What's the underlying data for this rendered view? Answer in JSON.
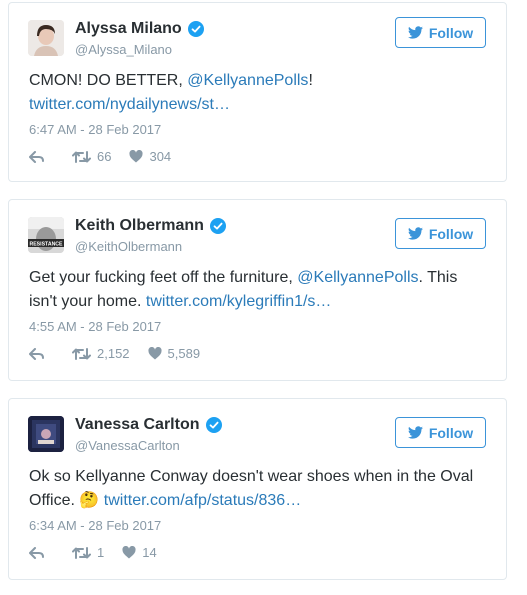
{
  "tweets": [
    {
      "name": "Alyssa Milano",
      "handle": "@Alyssa_Milano",
      "follow_label": "Follow",
      "text_before": "CMON! DO BETTER, ",
      "mention": "@KellyannePolls",
      "text_after": "!",
      "link": "twitter.com/nydailynews/st…",
      "timestamp": "6:47 AM - 28 Feb 2017",
      "retweets": "66",
      "likes": "304"
    },
    {
      "name": "Keith Olbermann",
      "handle": "@KeithOlbermann",
      "follow_label": "Follow",
      "text_before": "Get your fucking feet off the furniture, ",
      "mention": "@KellyannePolls",
      "text_after": ". This isn't your home. ",
      "link": "twitter.com/kylegriffin1/s…",
      "timestamp": "4:55 AM - 28 Feb 2017",
      "retweets": "2,152",
      "likes": "5,589",
      "avatar_text": "RESISTANCE"
    },
    {
      "name": "Vanessa Carlton",
      "handle": "@VanessaCarlton",
      "follow_label": "Follow",
      "text_before": "Ok so Kellyanne Conway doesn't wear shoes when in the Oval Office. ",
      "emoji": "🤔",
      "link": "twitter.com/afp/status/836…",
      "timestamp": "6:34 AM - 28 Feb 2017",
      "retweets": "1",
      "likes": "14"
    }
  ],
  "colors": {
    "link": "#2b7bb9",
    "follow": "#3b94d9",
    "muted": "#8899a6",
    "verified": "#1da1f2",
    "border": "#e1e8ed"
  }
}
